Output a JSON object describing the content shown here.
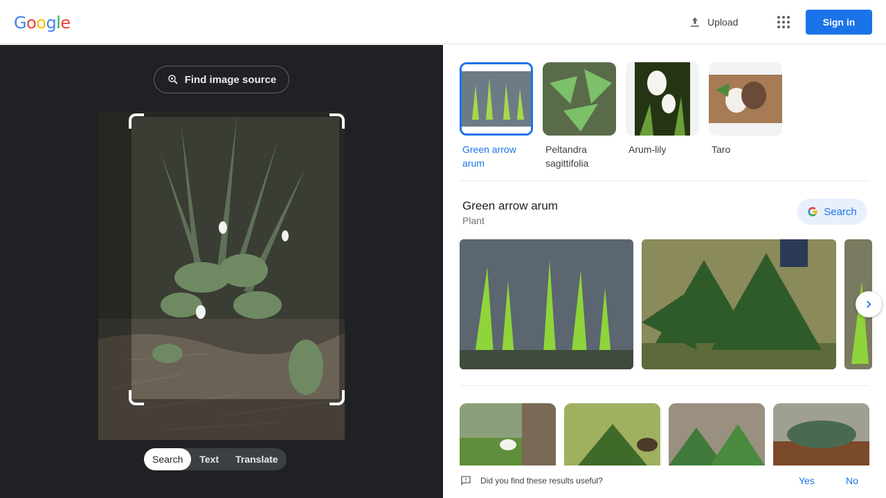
{
  "header": {
    "logo_letters": [
      {
        "ch": "G",
        "color": "#4285f4"
      },
      {
        "ch": "o",
        "color": "#ea4335"
      },
      {
        "ch": "o",
        "color": "#fbbc05"
      },
      {
        "ch": "g",
        "color": "#4285f4"
      },
      {
        "ch": "l",
        "color": "#34a853"
      },
      {
        "ch": "e",
        "color": "#ea4335"
      }
    ],
    "upload_label": "Upload",
    "signin_label": "Sign in"
  },
  "lens": {
    "find_source_label": "Find image source",
    "modes": [
      "Search",
      "Text",
      "Translate"
    ],
    "active_mode": "Search"
  },
  "results": {
    "chips": [
      {
        "label": "Green arrow arum",
        "selected": true
      },
      {
        "label": "Peltandra sagittifolia",
        "selected": false
      },
      {
        "label": "Arum-lily",
        "selected": false
      },
      {
        "label": "Taro",
        "selected": false
      }
    ],
    "entity": {
      "title": "Green arrow arum",
      "subtitle": "Plant",
      "search_label": "Search"
    },
    "feedback": {
      "question": "Did you find these results useful?",
      "yes": "Yes",
      "no": "No"
    }
  },
  "colors": {
    "accent": "#1a73e8",
    "dark_panel": "#202124"
  }
}
